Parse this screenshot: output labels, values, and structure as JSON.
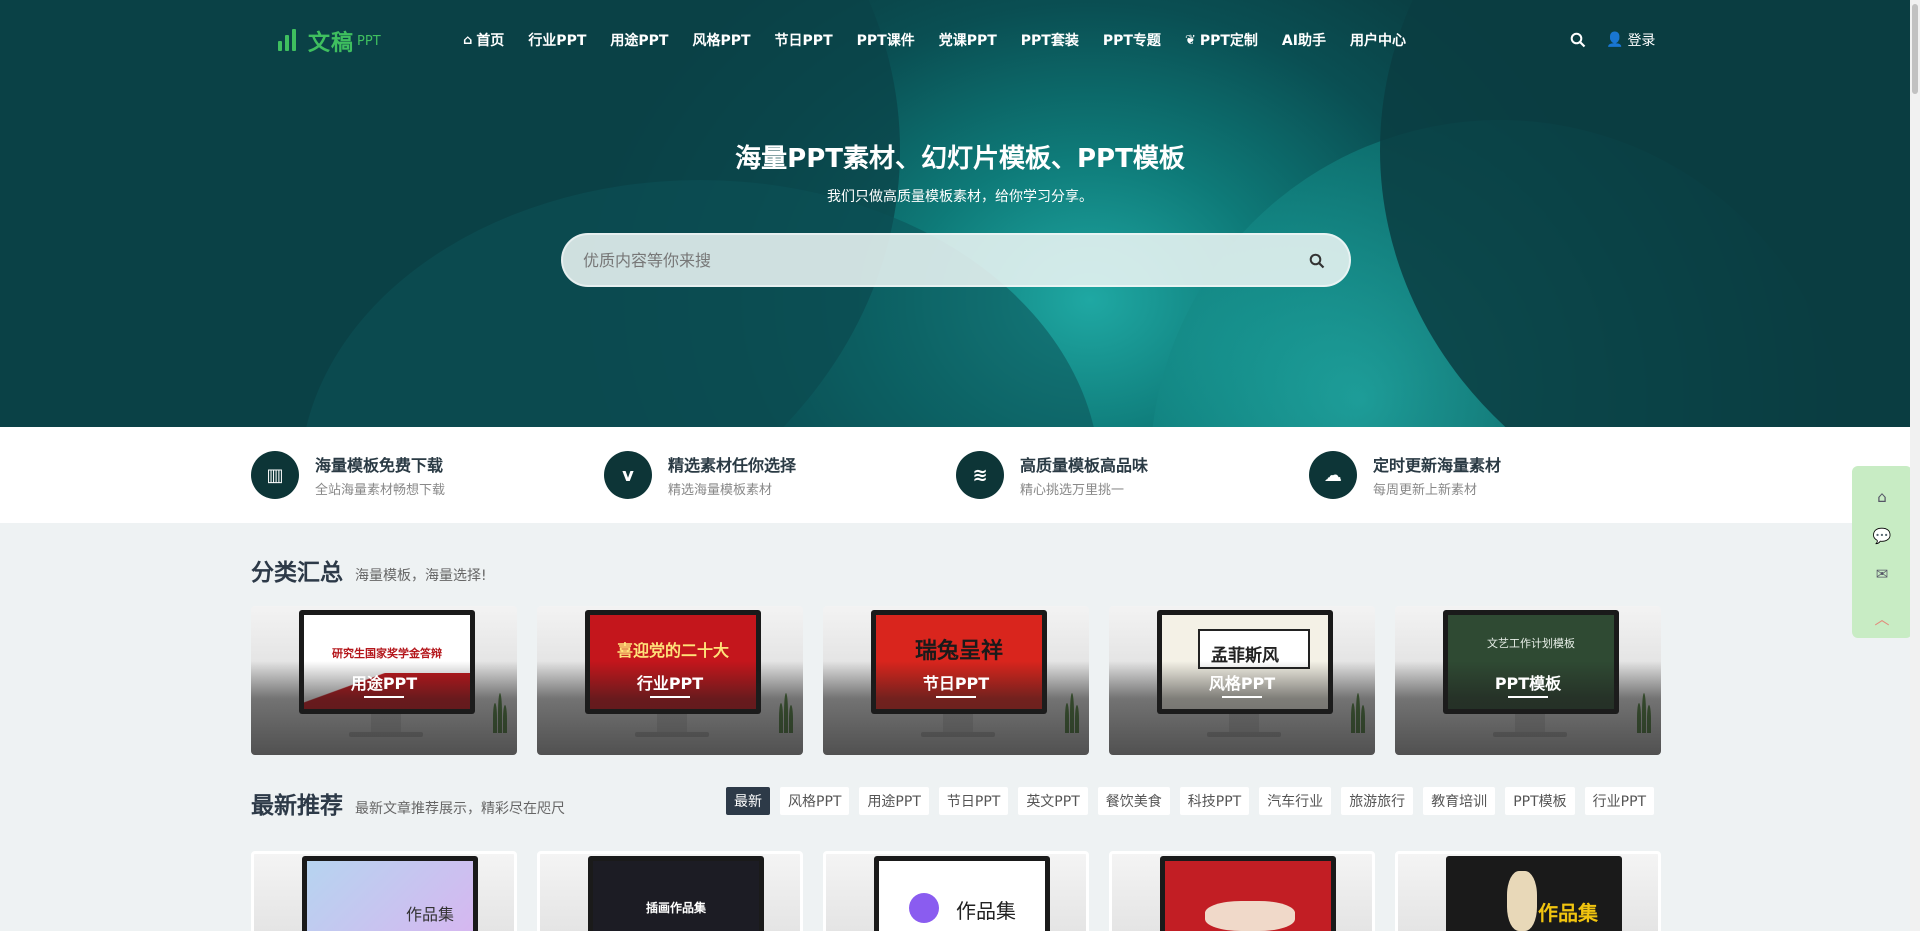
{
  "logo": {
    "text": "文稿",
    "sub": "PPT"
  },
  "nav": {
    "items": [
      {
        "label": "首页",
        "icon": "home-icon"
      },
      {
        "label": "行业PPT"
      },
      {
        "label": "用途PPT"
      },
      {
        "label": "风格PPT"
      },
      {
        "label": "节日PPT"
      },
      {
        "label": "PPT课件"
      },
      {
        "label": "党课PPT"
      },
      {
        "label": "PPT套装"
      },
      {
        "label": "PPT专题"
      },
      {
        "label": "PPT定制",
        "icon": "leaf-icon"
      },
      {
        "label": "AI助手"
      },
      {
        "label": "用户中心"
      }
    ],
    "login": "登录"
  },
  "hero": {
    "title": "海量PPT素材、幻灯片模板、PPT模板",
    "subtitle": "我们只做高质量模板素材，给你学习分享。",
    "search_placeholder": "优质内容等你来搜"
  },
  "features": [
    {
      "title": "海量模板免费下载",
      "desc": "全站海量素材畅想下载",
      "icon": "chart-icon"
    },
    {
      "title": "精选素材任你选择",
      "desc": "精选海量模板素材",
      "icon": "v-icon"
    },
    {
      "title": "高质量模板高品味",
      "desc": "精心挑选万里挑一",
      "icon": "layers-icon"
    },
    {
      "title": "定时更新海量素材",
      "desc": "每周更新上新素材",
      "icon": "cloud-icon"
    }
  ],
  "categories": {
    "heading": "分类汇总",
    "desc": "海量模板，海量选择!",
    "items": [
      {
        "label": "用途PPT",
        "screen_text": "研究生国家奖学金答辩",
        "screen_bg": "#ffffff",
        "screen_color": "#b4161b"
      },
      {
        "label": "行业PPT",
        "screen_text": "喜迎党的二十大",
        "screen_bg": "#c4161c",
        "screen_color": "#ffe27a"
      },
      {
        "label": "节日PPT",
        "screen_text": "瑞兔呈祥",
        "screen_bg": "#d9251d",
        "screen_color": "#1a1a1a"
      },
      {
        "label": "风格PPT",
        "screen_text": "孟菲斯风",
        "screen_bg": "#f4f1e6",
        "screen_color": "#222222"
      },
      {
        "label": "PPT模板",
        "screen_text": "文艺工作计划模板",
        "screen_bg": "#2f4a33",
        "screen_color": "#e8efe8"
      }
    ]
  },
  "latest": {
    "heading": "最新推荐",
    "desc": "最新文章推荐展示，精彩尽在咫尺",
    "tabs": [
      "最新",
      "风格PPT",
      "用途PPT",
      "节日PPT",
      "英文PPT",
      "餐饮美食",
      "科技PPT",
      "汽车行业",
      "旅游旅行",
      "教育培训",
      "PPT模板",
      "行业PPT"
    ],
    "posts": [
      {
        "screen_text": "作品集",
        "screen_bg": "#a9c6e8",
        "screen_color": "#333333"
      },
      {
        "screen_text": "插画作品集",
        "screen_bg": "#1c1c24",
        "screen_color": "#ffffff"
      },
      {
        "screen_text": "作品集",
        "screen_bg": "#ffffff",
        "screen_color": "#222222"
      },
      {
        "screen_text": "",
        "screen_bg": "#c21e24",
        "screen_color": "#ffffff"
      },
      {
        "screen_text": "作品集",
        "screen_bg": "#1a1a1a",
        "screen_color": "#f1c40f"
      }
    ]
  },
  "colors": {
    "brand_green": "#3fbf5f",
    "feature_circle": "#0d3537",
    "heading": "#2d3a48",
    "active_tab": "#2d3a48",
    "side_float": "#c8ecc4"
  }
}
